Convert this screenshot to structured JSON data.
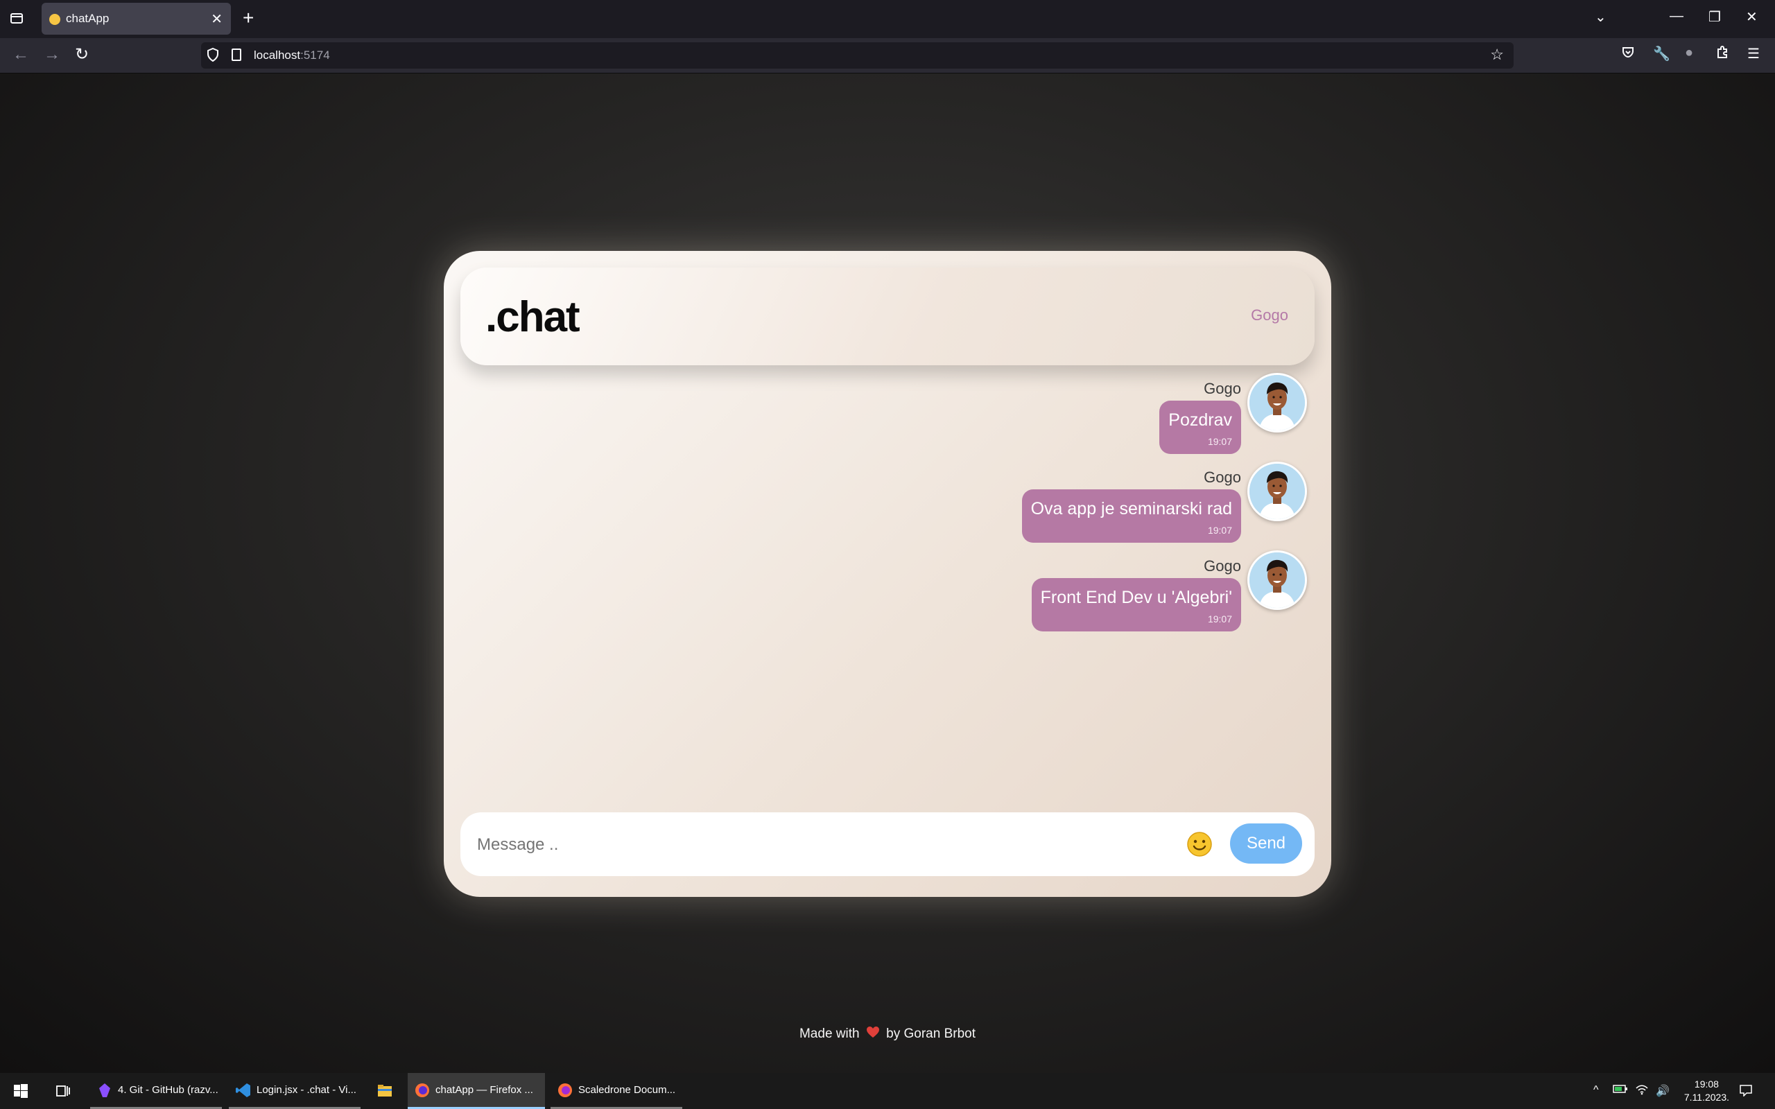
{
  "browser": {
    "tab_title": "chatApp",
    "url_host": "localhost",
    "url_port": ":5174"
  },
  "app": {
    "logo": ".chat",
    "current_user": "Gogo",
    "messages": [
      {
        "name": "Gogo",
        "text": "Pozdrav",
        "time": "19:07"
      },
      {
        "name": "Gogo",
        "text": "Ova app je seminarski rad",
        "time": "19:07"
      },
      {
        "name": "Gogo",
        "text": "Front End Dev u 'Algebri'",
        "time": "19:07"
      }
    ],
    "composer": {
      "placeholder": "Message ..",
      "send_label": "Send"
    },
    "footer": {
      "prefix": "Made with",
      "suffix": "by Goran Brbot"
    },
    "colors": {
      "bubble": "#b579a4",
      "send_button": "#74b8f5",
      "username": "#b479a7"
    }
  },
  "taskbar": {
    "items": [
      {
        "label": "4. Git - GitHub (razv...",
        "icon": "github-desktop-icon"
      },
      {
        "label": "Login.jsx - .chat - Vi...",
        "icon": "vscode-icon"
      },
      {
        "label": "",
        "icon": "file-explorer-icon"
      },
      {
        "label": "chatApp — Firefox ...",
        "icon": "firefox-icon"
      },
      {
        "label": "Scaledrone Docum...",
        "icon": "firefox-icon"
      }
    ],
    "clock_time": "19:08",
    "clock_date": "7.11.2023."
  }
}
